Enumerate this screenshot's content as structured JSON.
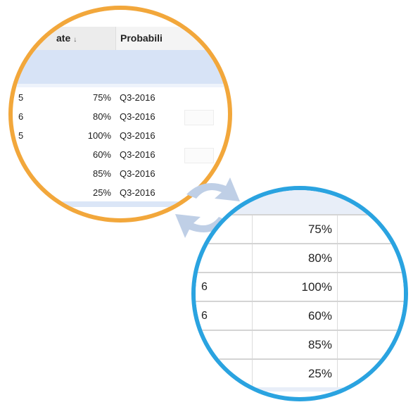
{
  "top_lens": {
    "header": {
      "col_left": "ate",
      "sort_icon": "arrow-down-icon",
      "col_right": "Probabili"
    },
    "rows": [
      {
        "lead": "5",
        "probability": "75%",
        "quarter": "Q3-2016"
      },
      {
        "lead": "6",
        "probability": "80%",
        "quarter": "Q3-2016"
      },
      {
        "lead": "5",
        "probability": "100%",
        "quarter": "Q3-2016"
      },
      {
        "lead": "",
        "probability": "60%",
        "quarter": "Q3-2016"
      },
      {
        "lead": "",
        "probability": "85%",
        "quarter": "Q3-2016"
      },
      {
        "lead": "",
        "probability": "25%",
        "quarter": "Q3-2016"
      }
    ]
  },
  "bottom_lens": {
    "rows": [
      {
        "lead": "",
        "probability": "75%"
      },
      {
        "lead": "",
        "probability": "80%"
      },
      {
        "lead": "6",
        "probability": "100%"
      },
      {
        "lead": "6",
        "probability": "60%"
      },
      {
        "lead": "",
        "probability": "85%"
      },
      {
        "lead": "",
        "probability": "25%"
      }
    ]
  },
  "colors": {
    "top_ring": "#f2a73b",
    "bottom_ring": "#2aa3e0",
    "sync_icon": "#bfcfe6",
    "row_band": "#d7e3f6"
  },
  "icon": "refresh-sync-icon"
}
